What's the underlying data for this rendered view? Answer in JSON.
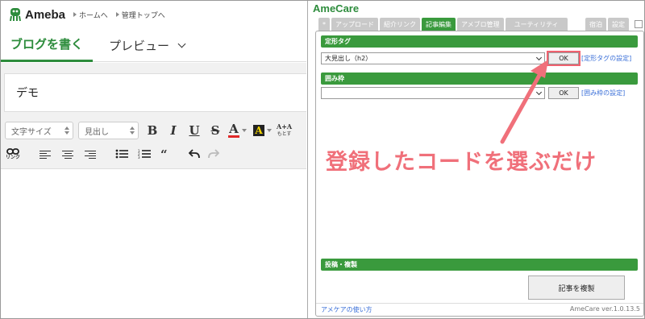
{
  "ameba": {
    "logo_text": "Ameba",
    "nav": [
      {
        "label": "ホームへ"
      },
      {
        "label": "管理トップへ"
      }
    ],
    "tabs": {
      "write": "ブログを書く",
      "preview": "プレビュー"
    },
    "title_value": "デモ",
    "toolbar": {
      "font_size": "文字サイズ",
      "heading": "見出し",
      "bold": "B",
      "italic": "I",
      "underline": "U",
      "strike": "S",
      "font_color": "A",
      "bg_color": "A",
      "aa": "A+A",
      "aa_sub": "もとす",
      "link": "リンク",
      "quote": "66"
    }
  },
  "amecare": {
    "title": "AmeCare",
    "tabs": [
      "*",
      "アップロード",
      "紹介リンク",
      "記事編集",
      "アメブロ管理",
      "ユーティリティ"
    ],
    "active_tab": "記事編集",
    "tabs_right": [
      "宿泊",
      "設定"
    ],
    "sections": {
      "template_tag": {
        "header": "定形タグ",
        "selected": "大見出し（h2）",
        "ok": "OK",
        "settings_link": "[定形タグの設定]"
      },
      "frame": {
        "header": "囲み枠",
        "selected": "",
        "ok": "OK",
        "settings_link": "[囲み枠の設定]"
      },
      "post": {
        "header": "投稿・複製",
        "duplicate_button": "記事を複製"
      }
    },
    "footer": {
      "howto_link": "アメケアの使い方",
      "version": "AmeCare ver.1.0.13.5"
    }
  },
  "annotation": {
    "text": "登録したコードを選ぶだけ",
    "color": "#f0707a"
  },
  "colors": {
    "accent_green": "#3a9a3d",
    "link_blue": "#3a6fd8",
    "highlight_red": "#f0626f"
  }
}
